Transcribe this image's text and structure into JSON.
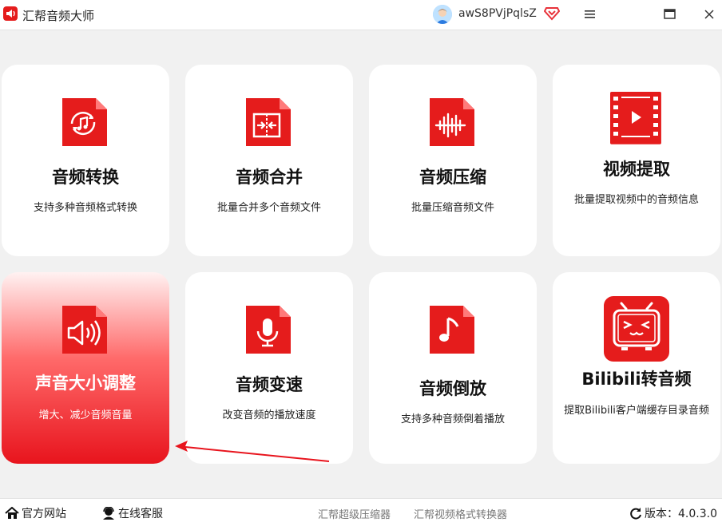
{
  "app": {
    "title": "汇帮音频大师"
  },
  "user": {
    "name": "awS8PVjPqlsZ"
  },
  "colors": {
    "accent": "#e51c1c",
    "card_bg": "#ffffff",
    "page_bg": "#f1f1f1"
  },
  "cards": [
    {
      "title": "音频转换",
      "desc": "支持多种音频格式转换",
      "icon": "audio-convert-icon"
    },
    {
      "title": "音频合并",
      "desc": "批量合并多个音频文件",
      "icon": "audio-merge-icon"
    },
    {
      "title": "音频压缩",
      "desc": "批量压缩音频文件",
      "icon": "audio-compress-icon"
    },
    {
      "title": "视频提取",
      "desc": "批量提取视频中的音频信息",
      "icon": "video-extract-icon"
    },
    {
      "title": "声音大小调整",
      "desc": "增大、减少音频音量",
      "icon": "volume-adjust-icon",
      "active": true
    },
    {
      "title": "音频变速",
      "desc": "改变音频的播放速度",
      "icon": "audio-speed-icon"
    },
    {
      "title": "音频倒放",
      "desc": "支持多种音频倒着播放",
      "icon": "audio-reverse-icon"
    },
    {
      "title": "Bilibili转音频",
      "desc": "提取Bilibili客户端缓存目录音频",
      "icon": "bilibili-icon"
    }
  ],
  "footer": {
    "website": "官方网站",
    "support": "在线客服",
    "link1": "汇帮超级压缩器",
    "link2": "汇帮视频格式转换器",
    "version": "版本：4.0.3.0"
  }
}
